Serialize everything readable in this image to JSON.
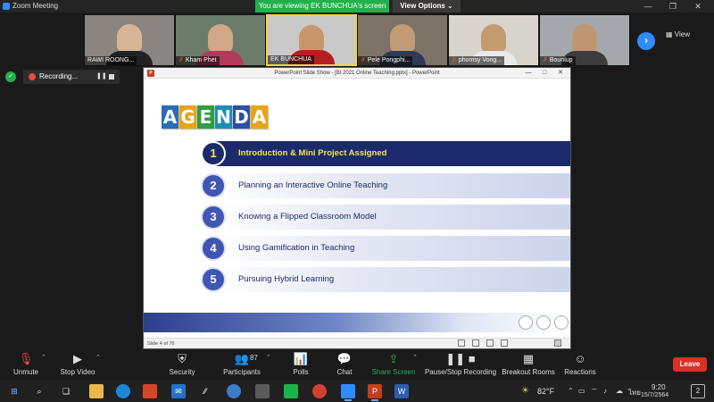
{
  "window": {
    "title": "Zoom Meeting",
    "viewing_banner": "You are viewing EK BUNCHUA's screen",
    "view_options": "View Options ⌄"
  },
  "gallery": {
    "participants": [
      {
        "name": "RAWI ROONG...",
        "muted": false
      },
      {
        "name": "Kham Phet",
        "muted": true
      },
      {
        "name": "EK BUNCHUA",
        "muted": false
      },
      {
        "name": "Pele Pongphi...",
        "muted": true
      },
      {
        "name": "phomsy Vong...",
        "muted": true
      },
      {
        "name": "Bounlup",
        "muted": true
      }
    ],
    "view_label": "View"
  },
  "recording": {
    "label": "Recording..."
  },
  "ppt": {
    "title": "PowerPoint Slide Show - [BI 2021 Online Teaching.pptx] - PowerPoint",
    "status": "Slide 4 of 76"
  },
  "slide": {
    "agenda_letters": [
      "A",
      "G",
      "E",
      "N",
      "D",
      "A"
    ],
    "agenda_colors": [
      "#2a6db5",
      "#e8a317",
      "#2f9e44",
      "#1d8fb3",
      "#2e4fa3",
      "#e8a317"
    ],
    "items": [
      {
        "num": "1",
        "label": "Introduction & Mini Project Assigned"
      },
      {
        "num": "2",
        "label": "Planning an Interactive Online Teaching"
      },
      {
        "num": "3",
        "label": "Knowing a Flipped Classroom Model"
      },
      {
        "num": "4",
        "label": "Using Gamification in Teaching"
      },
      {
        "num": "5",
        "label": "Pursuing Hybrid Learning"
      }
    ]
  },
  "toolbar": {
    "unmute": "Unmute",
    "stop_video": "Stop Video",
    "security": "Security",
    "participants": "Participants",
    "participant_count": "87",
    "polls": "Polls",
    "chat": "Chat",
    "share_screen": "Share Screen",
    "recording": "Pause/Stop Recording",
    "breakout": "Breakout Rooms",
    "reactions": "Reactions",
    "leave": "Leave"
  },
  "taskbar": {
    "temperature": "82°F",
    "language": "ไทย",
    "time": "9:20",
    "date": "15/7/2564",
    "notifications": "2"
  },
  "colors": {
    "zoom_blue": "#2d8cff",
    "banner_green": "#23b14d",
    "leave_red": "#d93025",
    "slide_navy": "#1b2a6b",
    "highlight_yellow": "#f7e44a"
  }
}
